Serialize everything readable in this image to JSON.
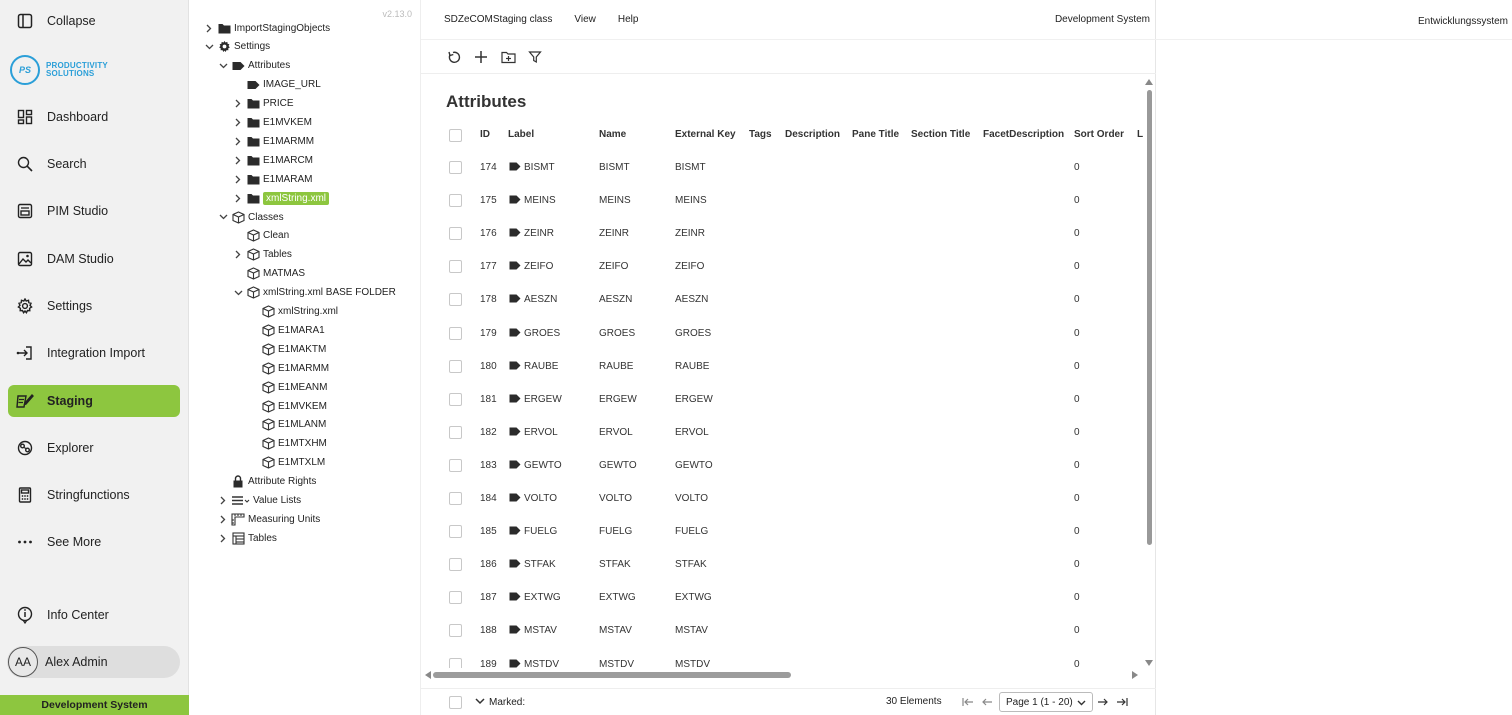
{
  "nav": {
    "collapse": "Collapse",
    "logo_mark": "PS",
    "logo_line1": "PRODUCTIVITY",
    "logo_line2": "SOLUTIONS",
    "items": [
      {
        "label": "Dashboard",
        "icon": "dashboard-icon"
      },
      {
        "label": "Search",
        "icon": "search-icon"
      },
      {
        "label": "PIM Studio",
        "icon": "pim-studio-icon"
      },
      {
        "label": "DAM Studio",
        "icon": "image-icon"
      },
      {
        "label": "Settings",
        "icon": "gear-icon"
      },
      {
        "label": "Integration Import",
        "icon": "import-icon"
      },
      {
        "label": "Staging",
        "icon": "staging-icon"
      },
      {
        "label": "Explorer",
        "icon": "explorer-icon"
      },
      {
        "label": "Stringfunctions",
        "icon": "calculator-icon"
      },
      {
        "label": "See More",
        "icon": "more-icon"
      }
    ],
    "info_center": "Info Center",
    "user_initials": "AA",
    "user_name": "Alex Admin",
    "environment": "Development System",
    "active_color": "#8dc63f"
  },
  "tree": {
    "version": "v2.13.0",
    "nodes": [
      {
        "label": "ImportStagingObjects",
        "expander": "collapsed",
        "icon": "folder-icon"
      },
      {
        "label": "Settings",
        "expander": "expanded",
        "icon": "gear-icon"
      },
      {
        "label": "Attributes",
        "expander": "expanded",
        "icon": "tag-icon"
      },
      {
        "label": "IMAGE_URL",
        "expander": "none",
        "icon": "tag-icon"
      },
      {
        "label": "PRICE",
        "expander": "collapsed",
        "icon": "folder-icon"
      },
      {
        "label": "E1MVKEM",
        "expander": "collapsed",
        "icon": "folder-icon"
      },
      {
        "label": "E1MARMM",
        "expander": "collapsed",
        "icon": "folder-icon"
      },
      {
        "label": "E1MARCM",
        "expander": "collapsed",
        "icon": "folder-icon"
      },
      {
        "label": "E1MARAM",
        "expander": "collapsed",
        "icon": "folder-icon"
      },
      {
        "label": "xmlString.xml",
        "expander": "collapsed",
        "icon": "folder-icon",
        "selected": true
      },
      {
        "label": "Classes",
        "expander": "expanded",
        "icon": "cube-icon"
      },
      {
        "label": "Clean",
        "expander": "none",
        "icon": "cube-icon"
      },
      {
        "label": "Tables",
        "expander": "collapsed",
        "icon": "cube-icon"
      },
      {
        "label": "MATMAS",
        "expander": "none",
        "icon": "cube-icon"
      },
      {
        "label": "xmlString.xml BASE FOLDER",
        "expander": "expanded",
        "icon": "cube-icon"
      },
      {
        "label": "xmlString.xml",
        "expander": "none",
        "icon": "cube-icon"
      },
      {
        "label": "E1MARA1",
        "expander": "none",
        "icon": "cube-icon"
      },
      {
        "label": "E1MAKTM",
        "expander": "none",
        "icon": "cube-icon"
      },
      {
        "label": "E1MARMM",
        "expander": "none",
        "icon": "cube-icon"
      },
      {
        "label": "E1MEANM",
        "expander": "none",
        "icon": "cube-icon"
      },
      {
        "label": "E1MVKEM",
        "expander": "none",
        "icon": "cube-icon"
      },
      {
        "label": "E1MLANM",
        "expander": "none",
        "icon": "cube-icon"
      },
      {
        "label": "E1MTXHM",
        "expander": "none",
        "icon": "cube-icon"
      },
      {
        "label": "E1MTXLM",
        "expander": "none",
        "icon": "cube-icon"
      },
      {
        "label": "Attribute Rights",
        "expander": "none",
        "icon": "lock-icon"
      },
      {
        "label": "Value Lists",
        "expander": "collapsed",
        "icon": "list-icon"
      },
      {
        "label": "Measuring Units",
        "expander": "collapsed",
        "icon": "ruler-icon"
      },
      {
        "label": "Tables",
        "expander": "collapsed",
        "icon": "table-icon"
      }
    ]
  },
  "content": {
    "menu": [
      "SDZeCOMStaging class",
      "View",
      "Help"
    ],
    "system_label": "Development System",
    "toolbar": [
      "refresh-icon",
      "add-icon",
      "add-folder-icon",
      "filter-icon"
    ],
    "title": "Attributes",
    "columns": [
      "ID",
      "Label",
      "Name",
      "External Key",
      "Tags",
      "Description",
      "Pane Title",
      "Section Title",
      "FacetDescription",
      "Sort Order",
      "L"
    ],
    "rows": [
      {
        "id": "174",
        "label": "BISMT",
        "name": "BISMT",
        "key": "BISMT",
        "sort": "0"
      },
      {
        "id": "175",
        "label": "MEINS",
        "name": "MEINS",
        "key": "MEINS",
        "sort": "0"
      },
      {
        "id": "176",
        "label": "ZEINR",
        "name": "ZEINR",
        "key": "ZEINR",
        "sort": "0"
      },
      {
        "id": "177",
        "label": "ZEIFO",
        "name": "ZEIFO",
        "key": "ZEIFO",
        "sort": "0"
      },
      {
        "id": "178",
        "label": "AESZN",
        "name": "AESZN",
        "key": "AESZN",
        "sort": "0"
      },
      {
        "id": "179",
        "label": "GROES",
        "name": "GROES",
        "key": "GROES",
        "sort": "0"
      },
      {
        "id": "180",
        "label": "RAUBE",
        "name": "RAUBE",
        "key": "RAUBE",
        "sort": "0"
      },
      {
        "id": "181",
        "label": "ERGEW",
        "name": "ERGEW",
        "key": "ERGEW",
        "sort": "0"
      },
      {
        "id": "182",
        "label": "ERVOL",
        "name": "ERVOL",
        "key": "ERVOL",
        "sort": "0"
      },
      {
        "id": "183",
        "label": "GEWTO",
        "name": "GEWTO",
        "key": "GEWTO",
        "sort": "0"
      },
      {
        "id": "184",
        "label": "VOLTO",
        "name": "VOLTO",
        "key": "VOLTO",
        "sort": "0"
      },
      {
        "id": "185",
        "label": "FUELG",
        "name": "FUELG",
        "key": "FUELG",
        "sort": "0"
      },
      {
        "id": "186",
        "label": "STFAK",
        "name": "STFAK",
        "key": "STFAK",
        "sort": "0"
      },
      {
        "id": "187",
        "label": "EXTWG",
        "name": "EXTWG",
        "key": "EXTWG",
        "sort": "0"
      },
      {
        "id": "188",
        "label": "MSTAV",
        "name": "MSTAV",
        "key": "MSTAV",
        "sort": "0"
      },
      {
        "id": "189",
        "label": "MSTDV",
        "name": "MSTDV",
        "key": "MSTDV",
        "sort": "0"
      }
    ],
    "footer": {
      "marked": "Marked:",
      "count": "30 Elements",
      "page": "Page 1 (1 - 20)"
    }
  },
  "right": {
    "system_label": "Entwicklungssystem"
  }
}
